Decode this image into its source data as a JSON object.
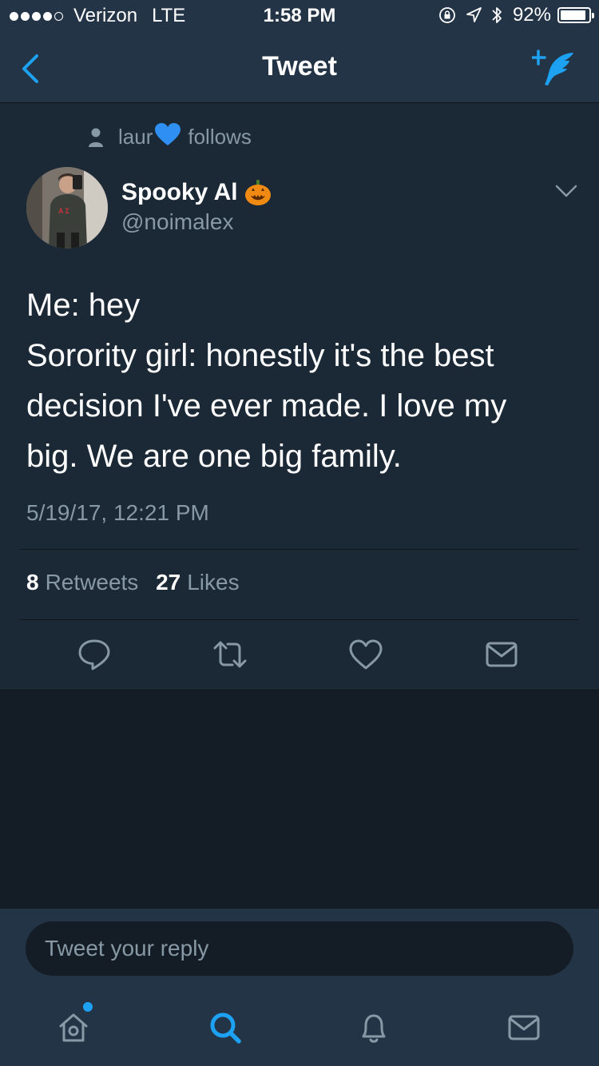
{
  "status_bar": {
    "carrier": "Verizon",
    "network": "LTE",
    "time": "1:58 PM",
    "battery": "92%",
    "battery_level": 0.92,
    "signal_bars_filled": 4,
    "signal_bars_total": 5
  },
  "nav": {
    "title": "Tweet",
    "back_icon": "chevron-left-icon",
    "compose_icon": "compose-tweet-icon"
  },
  "tweet": {
    "social_context": {
      "name": "laur",
      "emoji": "💙",
      "suffix": "follows"
    },
    "author": {
      "display_name": "Spooky Al",
      "emoji": "jack-o-lantern",
      "handle": "@noimalex"
    },
    "text_lines": [
      "Me: hey",
      "Sorority girl: honestly it's the best",
      "decision I've ever made. I love my",
      "big. We are one big family."
    ],
    "timestamp": "5/19/17, 12:21 PM",
    "stats": {
      "retweets_count": "8",
      "retweets_label": "Retweets",
      "likes_count": "27",
      "likes_label": "Likes"
    }
  },
  "reply": {
    "placeholder": "Tweet your reply"
  },
  "tabs": [
    "home-icon",
    "search-icon",
    "notifications-icon",
    "messages-icon"
  ],
  "colors": {
    "background": "#141d26",
    "card": "#1b2836",
    "bar": "#243447",
    "accent": "#1da1f2",
    "secondary_text": "#8899a6"
  }
}
